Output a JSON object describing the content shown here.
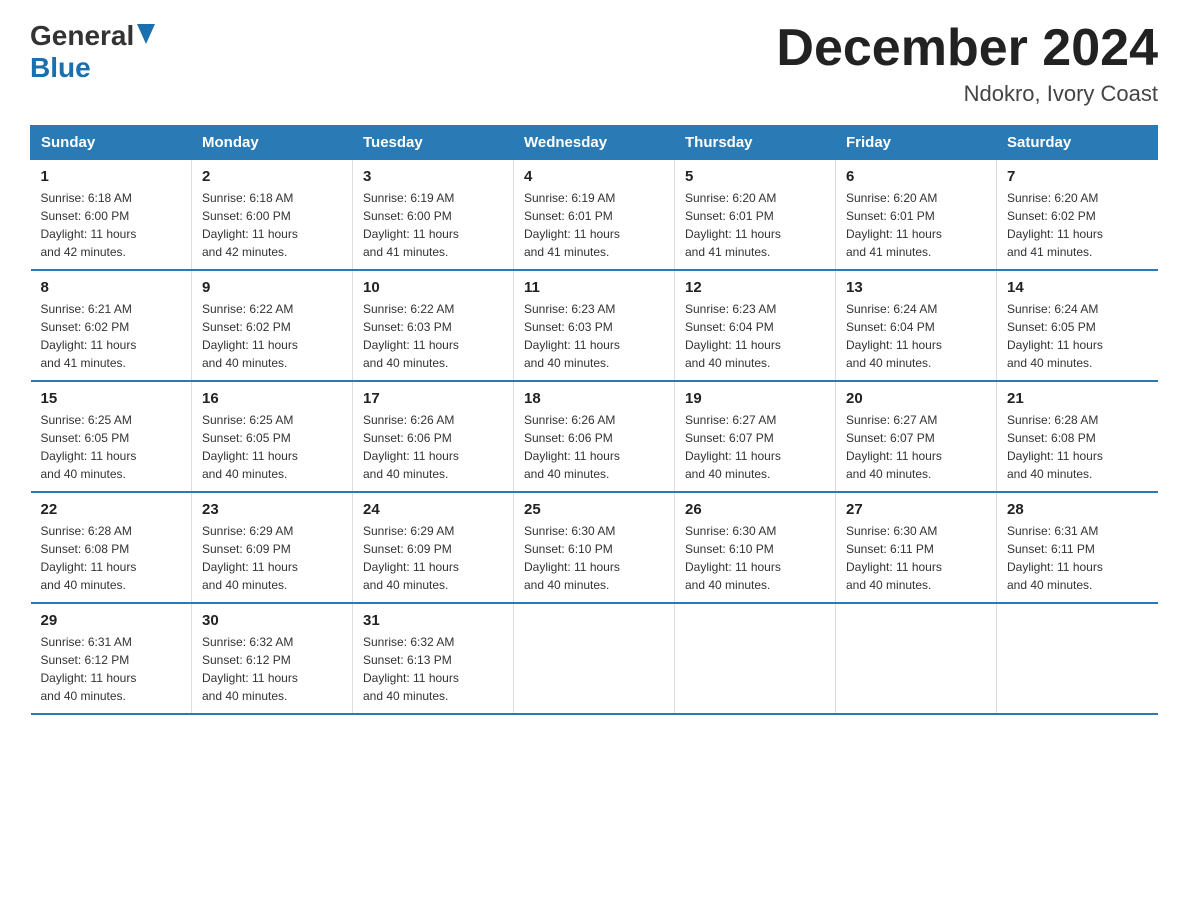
{
  "logo": {
    "general": "General",
    "blue": "Blue"
  },
  "title": {
    "month_year": "December 2024",
    "location": "Ndokro, Ivory Coast"
  },
  "headers": [
    "Sunday",
    "Monday",
    "Tuesday",
    "Wednesday",
    "Thursday",
    "Friday",
    "Saturday"
  ],
  "weeks": [
    [
      {
        "day": "1",
        "sunrise": "6:18 AM",
        "sunset": "6:00 PM",
        "daylight": "11 hours and 42 minutes."
      },
      {
        "day": "2",
        "sunrise": "6:18 AM",
        "sunset": "6:00 PM",
        "daylight": "11 hours and 42 minutes."
      },
      {
        "day": "3",
        "sunrise": "6:19 AM",
        "sunset": "6:00 PM",
        "daylight": "11 hours and 41 minutes."
      },
      {
        "day": "4",
        "sunrise": "6:19 AM",
        "sunset": "6:01 PM",
        "daylight": "11 hours and 41 minutes."
      },
      {
        "day": "5",
        "sunrise": "6:20 AM",
        "sunset": "6:01 PM",
        "daylight": "11 hours and 41 minutes."
      },
      {
        "day": "6",
        "sunrise": "6:20 AM",
        "sunset": "6:01 PM",
        "daylight": "11 hours and 41 minutes."
      },
      {
        "day": "7",
        "sunrise": "6:20 AM",
        "sunset": "6:02 PM",
        "daylight": "11 hours and 41 minutes."
      }
    ],
    [
      {
        "day": "8",
        "sunrise": "6:21 AM",
        "sunset": "6:02 PM",
        "daylight": "11 hours and 41 minutes."
      },
      {
        "day": "9",
        "sunrise": "6:22 AM",
        "sunset": "6:02 PM",
        "daylight": "11 hours and 40 minutes."
      },
      {
        "day": "10",
        "sunrise": "6:22 AM",
        "sunset": "6:03 PM",
        "daylight": "11 hours and 40 minutes."
      },
      {
        "day": "11",
        "sunrise": "6:23 AM",
        "sunset": "6:03 PM",
        "daylight": "11 hours and 40 minutes."
      },
      {
        "day": "12",
        "sunrise": "6:23 AM",
        "sunset": "6:04 PM",
        "daylight": "11 hours and 40 minutes."
      },
      {
        "day": "13",
        "sunrise": "6:24 AM",
        "sunset": "6:04 PM",
        "daylight": "11 hours and 40 minutes."
      },
      {
        "day": "14",
        "sunrise": "6:24 AM",
        "sunset": "6:05 PM",
        "daylight": "11 hours and 40 minutes."
      }
    ],
    [
      {
        "day": "15",
        "sunrise": "6:25 AM",
        "sunset": "6:05 PM",
        "daylight": "11 hours and 40 minutes."
      },
      {
        "day": "16",
        "sunrise": "6:25 AM",
        "sunset": "6:05 PM",
        "daylight": "11 hours and 40 minutes."
      },
      {
        "day": "17",
        "sunrise": "6:26 AM",
        "sunset": "6:06 PM",
        "daylight": "11 hours and 40 minutes."
      },
      {
        "day": "18",
        "sunrise": "6:26 AM",
        "sunset": "6:06 PM",
        "daylight": "11 hours and 40 minutes."
      },
      {
        "day": "19",
        "sunrise": "6:27 AM",
        "sunset": "6:07 PM",
        "daylight": "11 hours and 40 minutes."
      },
      {
        "day": "20",
        "sunrise": "6:27 AM",
        "sunset": "6:07 PM",
        "daylight": "11 hours and 40 minutes."
      },
      {
        "day": "21",
        "sunrise": "6:28 AM",
        "sunset": "6:08 PM",
        "daylight": "11 hours and 40 minutes."
      }
    ],
    [
      {
        "day": "22",
        "sunrise": "6:28 AM",
        "sunset": "6:08 PM",
        "daylight": "11 hours and 40 minutes."
      },
      {
        "day": "23",
        "sunrise": "6:29 AM",
        "sunset": "6:09 PM",
        "daylight": "11 hours and 40 minutes."
      },
      {
        "day": "24",
        "sunrise": "6:29 AM",
        "sunset": "6:09 PM",
        "daylight": "11 hours and 40 minutes."
      },
      {
        "day": "25",
        "sunrise": "6:30 AM",
        "sunset": "6:10 PM",
        "daylight": "11 hours and 40 minutes."
      },
      {
        "day": "26",
        "sunrise": "6:30 AM",
        "sunset": "6:10 PM",
        "daylight": "11 hours and 40 minutes."
      },
      {
        "day": "27",
        "sunrise": "6:30 AM",
        "sunset": "6:11 PM",
        "daylight": "11 hours and 40 minutes."
      },
      {
        "day": "28",
        "sunrise": "6:31 AM",
        "sunset": "6:11 PM",
        "daylight": "11 hours and 40 minutes."
      }
    ],
    [
      {
        "day": "29",
        "sunrise": "6:31 AM",
        "sunset": "6:12 PM",
        "daylight": "11 hours and 40 minutes."
      },
      {
        "day": "30",
        "sunrise": "6:32 AM",
        "sunset": "6:12 PM",
        "daylight": "11 hours and 40 minutes."
      },
      {
        "day": "31",
        "sunrise": "6:32 AM",
        "sunset": "6:13 PM",
        "daylight": "11 hours and 40 minutes."
      },
      null,
      null,
      null,
      null
    ]
  ],
  "labels": {
    "sunrise": "Sunrise:",
    "sunset": "Sunset:",
    "daylight": "Daylight:"
  }
}
